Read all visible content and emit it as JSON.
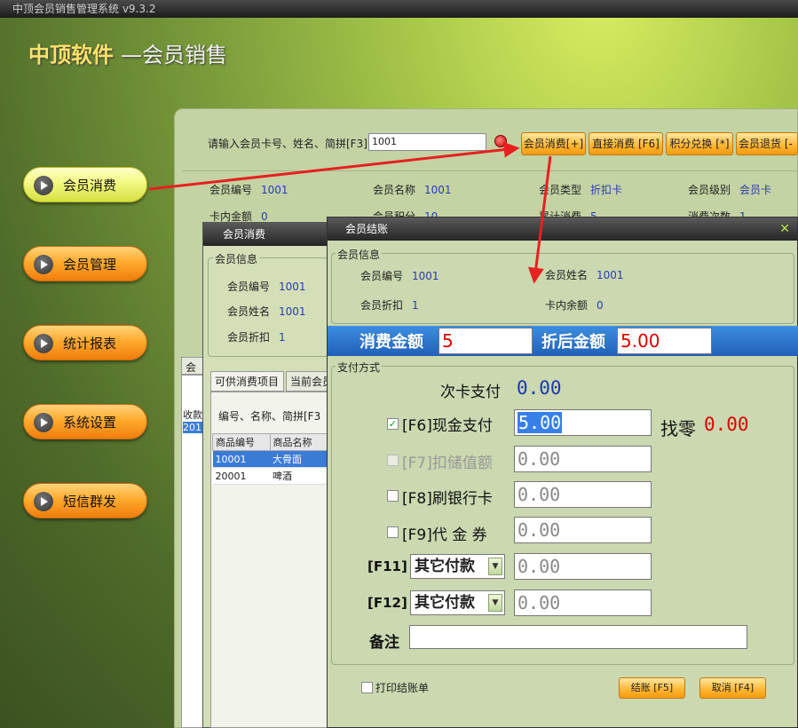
{
  "window": {
    "title": "中顶会员销售管理系统 v9.3.2"
  },
  "brand": {
    "name": "中顶软件",
    "subtitle": "—会员销售"
  },
  "sidebar": {
    "items": [
      {
        "label": "会员消费"
      },
      {
        "label": "会员管理"
      },
      {
        "label": "统计报表"
      },
      {
        "label": "系统设置"
      },
      {
        "label": "短信群发"
      }
    ]
  },
  "search": {
    "label": "请输入会员卡号、姓名、简拼[F3]",
    "value": "1001"
  },
  "toolbar": {
    "buttons": [
      "会员消费[+]",
      "直接消费 [F6]",
      "积分兑换 [*]",
      "会员退货 [-"
    ]
  },
  "member": {
    "id_label": "会员编号",
    "id": "1001",
    "name_label": "会员名称",
    "name": "1001",
    "type_label": "会员类型",
    "type": "折扣卡",
    "level_label": "会员级别",
    "level": "会员卡",
    "balance_label": "卡内金额",
    "balance": "0",
    "points_label": "会员积分",
    "points": "10",
    "total_label": "累计消费",
    "total": "5",
    "count_label": "消费次数",
    "count": "1"
  },
  "bg_tabs": {
    "tab1": "会员",
    "col": "收款",
    "row": "201"
  },
  "consume_window": {
    "title": "会员消费",
    "group_title": "会员信息",
    "id_label": "会员编号",
    "id": "1001",
    "name_label": "会员姓名",
    "name": "1001",
    "discount_label": "会员折扣",
    "discount": "1",
    "tabs": [
      "可供消费项目",
      "当前会员"
    ],
    "filter_label": "编号、名称、简拼[F3",
    "columns": [
      "商品编号",
      "商品名称"
    ],
    "rows": [
      [
        "10001",
        "大骨面"
      ],
      [
        "20001",
        "啤酒"
      ]
    ]
  },
  "checkout": {
    "title": "会员结账",
    "member_group": "会员信息",
    "id_label": "会员编号",
    "id": "1001",
    "name_label": "会员姓名",
    "name": "1001",
    "discount_label": "会员折扣",
    "discount": "1",
    "balance_label": "卡内余额",
    "balance": "0",
    "amount_label": "消费金额",
    "amount": "5",
    "after_label": "折后金额",
    "after": "5.00",
    "pay_group": "支付方式",
    "card_label": "次卡支付",
    "card_value": "0.00",
    "cash_label": "[F6]现金支付",
    "cash_value": "5.00",
    "cash_checked": "✓",
    "change_label": "找零",
    "change_value": "0.00",
    "stored_label": "[F7]扣储值额",
    "stored_value": "0.00",
    "bank_label": "[F8]刷银行卡",
    "bank_value": "0.00",
    "voucher_label": "[F9]代 金 券",
    "voucher_value": "0.00",
    "f11_label": "[F11]",
    "f11_select": "其它付款",
    "f11_value": "0.00",
    "f12_label": "[F12]",
    "f12_select": "其它付款",
    "f12_value": "0.00",
    "note_label": "备注",
    "note_value": "",
    "print_label": "打印结账单",
    "ok_button": "结账 [F5]",
    "cancel_button": "取消 [F4]"
  }
}
